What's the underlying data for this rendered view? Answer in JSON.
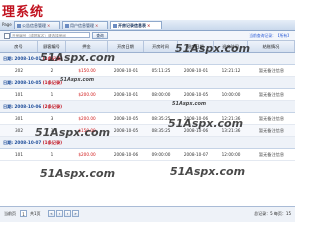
{
  "app_title": "理系统",
  "tabs": [
    {
      "label": "Page",
      "active": false
    },
    {
      "label": "公告信息管理",
      "active": false
    },
    {
      "label": "用户信息管理",
      "active": false
    },
    {
      "label": "开房记录信息表",
      "active": true
    }
  ],
  "toolbar": {
    "search_placeholder": "开房编号（或顾客名）请选择房间",
    "search_button": "查询",
    "right_text": "当前查询记录：【所有】"
  },
  "columns": [
    "房号",
    "顾客编号",
    "押金",
    "开房日期",
    "开房时间",
    "退房日期",
    "退房时间",
    "结账情况"
  ],
  "groups": [
    {
      "label": "日期: 2008-10-01",
      "count": "(1条记录)",
      "rows": [
        {
          "cells": [
            "202",
            "2",
            "$150.00",
            "2008-10-01",
            "05:11:25",
            "2008-10-01",
            "12:21:12",
            "暂无备注信息"
          ]
        }
      ]
    },
    {
      "label": "日期: 2008-10-05",
      "count": "(1条记录)",
      "rows": [
        {
          "cells": [
            "101",
            "1",
            "$200.00",
            "2008-10-01",
            "08:00:00",
            "2008-10-05",
            "10:00:00",
            "暂无备注信息"
          ]
        }
      ]
    },
    {
      "label": "日期: 2008-10-06",
      "count": "(2条记录)",
      "rows": [
        {
          "cells": [
            "301",
            "3",
            "$200.00",
            "2008-10-05",
            "08:35:25",
            "2008-10-06",
            "12:21:36",
            "暂无备注信息"
          ]
        },
        {
          "cells": [
            "302",
            "3",
            "$150.00",
            "2008-10-05",
            "08:35:25",
            "2008-10-06",
            "13:21:36",
            "暂无备注信息"
          ]
        }
      ]
    },
    {
      "label": "日期: 2008-10-07",
      "count": "(1条记录)",
      "rows": [
        {
          "cells": [
            "101",
            "1",
            "$200.00",
            "2008-10-06",
            "09:00:00",
            "2008-10-07",
            "12:00:00",
            "暂无备注信息"
          ]
        }
      ]
    }
  ],
  "watermark": {
    "big": "51Aspx.com",
    "small": "51Aspx.com"
  },
  "footer": {
    "page_label": "当前页",
    "page_value": "1",
    "total_pages": "共1页",
    "right_text": "总记录：5 每页：15"
  }
}
